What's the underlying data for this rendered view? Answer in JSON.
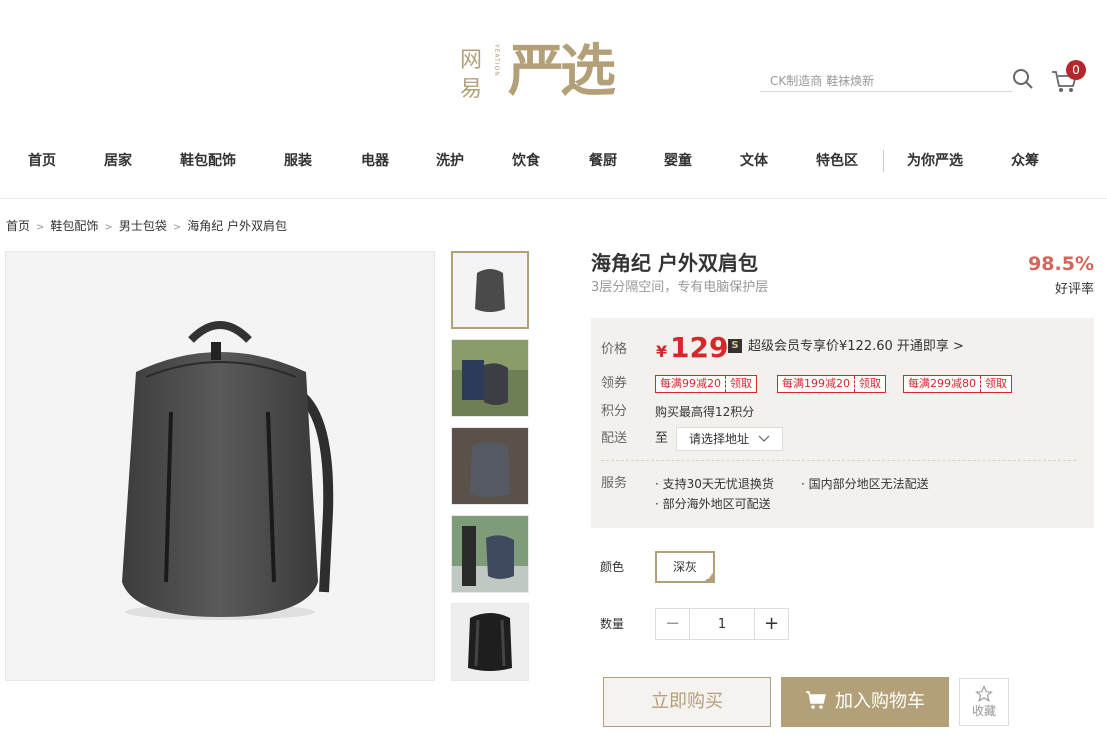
{
  "brand": {
    "logo_left": "网易",
    "logo_small": "YEATION",
    "logo_main": "严选"
  },
  "search": {
    "placeholder": "CK制造商 鞋袜焕新"
  },
  "cart": {
    "count": "0"
  },
  "nav": {
    "items": [
      "首页",
      "居家",
      "鞋包配饰",
      "服装",
      "电器",
      "洗护",
      "饮食",
      "餐厨",
      "婴童",
      "文体",
      "特色区",
      "为你严选",
      "众筹"
    ]
  },
  "breadcrumb": [
    "首页",
    "鞋包配饰",
    "男士包袋",
    "海角纪 户外双肩包"
  ],
  "product": {
    "title": "海角纪 户外双肩包",
    "subtitle": "3层分隔空间，专有电脑保护层",
    "rating": "98.5%",
    "rating_label": "好评率"
  },
  "price_box": {
    "price_label": "价格",
    "currency": "¥",
    "price": "129",
    "vip_icon": "S",
    "vip_text": "超级会员专享价¥122.60  开通即享 >",
    "coupon_label": "领券",
    "coupons": [
      {
        "amount": "每满99减20",
        "action": "领取"
      },
      {
        "amount": "每满199减20",
        "action": "领取"
      },
      {
        "amount": "每满299减80",
        "action": "领取"
      }
    ],
    "points_label": "积分",
    "points_text": "购买最高得12积分",
    "delivery_label": "配送",
    "delivery_to": "至",
    "address_placeholder": "请选择地址",
    "service_label": "服务",
    "services": [
      "支持30天无忧退换货",
      "国内部分地区无法配送",
      "部分海外地区可配送"
    ]
  },
  "options": {
    "color_label": "颜色",
    "color_value": "深灰",
    "qty_label": "数量",
    "qty_value": "1",
    "minus": "−",
    "plus": "+"
  },
  "actions": {
    "buy_now": "立即购买",
    "add_cart": "加入购物车",
    "favorite": "收藏"
  },
  "colors": {
    "accent": "#b4a078",
    "price_red": "#d4282d",
    "rating": "#d4655a",
    "box_bg": "#f3f1ed"
  }
}
